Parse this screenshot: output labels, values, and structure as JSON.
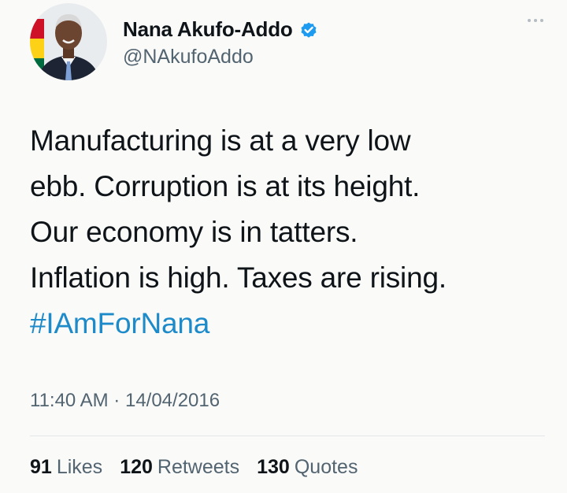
{
  "author": {
    "name": "Nana Akufo-Addo",
    "handle": "@NAkufoAddo",
    "verified": true
  },
  "tweet": {
    "lines": [
      "Manufacturing is at a very low",
      "ebb. Corruption is at its height.",
      "Our economy is in tatters.",
      "Inflation is high. Taxes are rising."
    ],
    "hashtag": "#IAmForNana",
    "time": "11:40 AM",
    "separator": "·",
    "date": "14/04/2016"
  },
  "stats": {
    "likes_count": "91",
    "likes_label": "Likes",
    "retweets_count": "120",
    "retweets_label": "Retweets",
    "quotes_count": "130",
    "quotes_label": "Quotes"
  },
  "colors": {
    "hashtag": "#1d8ac9",
    "verified_badge": "#1d9bf0",
    "secondary_text": "#536471"
  },
  "icons": {
    "avatar": "profile-photo",
    "verified": "verified-badge-icon",
    "more": "more-options-icon"
  }
}
